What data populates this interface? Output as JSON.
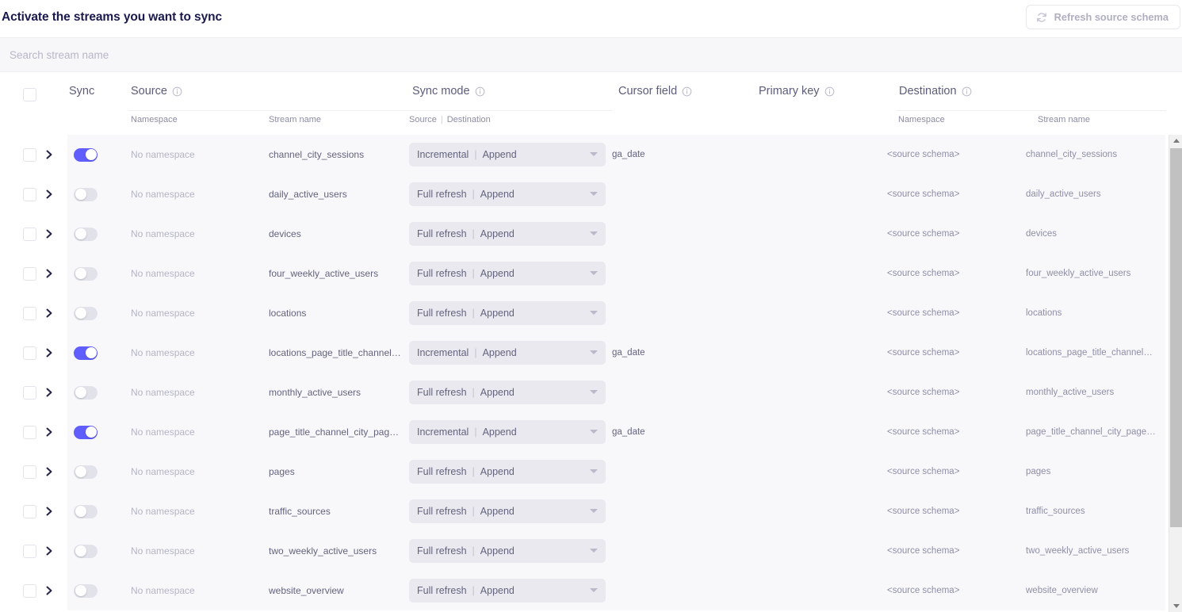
{
  "header": {
    "title": "Activate the streams you want to sync",
    "refresh_button": {
      "label": "Refresh source schema",
      "icon": "refresh-icon",
      "disabled": true
    }
  },
  "search": {
    "value": "",
    "placeholder": "Search stream name"
  },
  "table": {
    "columns": {
      "sync": "Sync",
      "source": "Source",
      "sync_mode": "Sync mode",
      "cursor_field": "Cursor field",
      "primary_key": "Primary key",
      "destination": "Destination"
    },
    "subcolumns": {
      "source_namespace": "Namespace",
      "source_stream_name": "Stream name",
      "sync_mode_source": "Source",
      "sync_mode_separator": "|",
      "sync_mode_destination": "Destination",
      "dest_namespace": "Namespace",
      "dest_stream_name": "Stream name"
    },
    "rows": [
      {
        "enabled": true,
        "checked": false,
        "namespace": "No namespace",
        "stream_name": "channel_city_sessions",
        "sync_mode_source": "Incremental",
        "sync_mode_separator": "|",
        "sync_mode_destination": "Append",
        "cursor_field": "ga_date",
        "primary_key": "",
        "dest_namespace": "<source schema>",
        "dest_stream_name": "channel_city_sessions"
      },
      {
        "enabled": false,
        "checked": false,
        "namespace": "No namespace",
        "stream_name": "daily_active_users",
        "sync_mode_source": "Full refresh",
        "sync_mode_separator": "|",
        "sync_mode_destination": "Append",
        "cursor_field": "",
        "primary_key": "",
        "dest_namespace": "<source schema>",
        "dest_stream_name": "daily_active_users"
      },
      {
        "enabled": false,
        "checked": false,
        "namespace": "No namespace",
        "stream_name": "devices",
        "sync_mode_source": "Full refresh",
        "sync_mode_separator": "|",
        "sync_mode_destination": "Append",
        "cursor_field": "",
        "primary_key": "",
        "dest_namespace": "<source schema>",
        "dest_stream_name": "devices"
      },
      {
        "enabled": false,
        "checked": false,
        "namespace": "No namespace",
        "stream_name": "four_weekly_active_users",
        "sync_mode_source": "Full refresh",
        "sync_mode_separator": "|",
        "sync_mode_destination": "Append",
        "cursor_field": "",
        "primary_key": "",
        "dest_namespace": "<source schema>",
        "dest_stream_name": "four_weekly_active_users"
      },
      {
        "enabled": false,
        "checked": false,
        "namespace": "No namespace",
        "stream_name": "locations",
        "sync_mode_source": "Full refresh",
        "sync_mode_separator": "|",
        "sync_mode_destination": "Append",
        "cursor_field": "",
        "primary_key": "",
        "dest_namespace": "<source schema>",
        "dest_stream_name": "locations"
      },
      {
        "enabled": true,
        "checked": false,
        "namespace": "No namespace",
        "stream_name": "locations_page_title_channel_cit...",
        "sync_mode_source": "Incremental",
        "sync_mode_separator": "|",
        "sync_mode_destination": "Append",
        "cursor_field": "ga_date",
        "primary_key": "",
        "dest_namespace": "<source schema>",
        "dest_stream_name": "locations_page_title_channel_cit..."
      },
      {
        "enabled": false,
        "checked": false,
        "namespace": "No namespace",
        "stream_name": "monthly_active_users",
        "sync_mode_source": "Full refresh",
        "sync_mode_separator": "|",
        "sync_mode_destination": "Append",
        "cursor_field": "",
        "primary_key": "",
        "dest_namespace": "<source schema>",
        "dest_stream_name": "monthly_active_users"
      },
      {
        "enabled": true,
        "checked": false,
        "namespace": "No namespace",
        "stream_name": "page_title_channel_city_pagevie...",
        "sync_mode_source": "Incremental",
        "sync_mode_separator": "|",
        "sync_mode_destination": "Append",
        "cursor_field": "ga_date",
        "primary_key": "",
        "dest_namespace": "<source schema>",
        "dest_stream_name": "page_title_channel_city_pagevie..."
      },
      {
        "enabled": false,
        "checked": false,
        "namespace": "No namespace",
        "stream_name": "pages",
        "sync_mode_source": "Full refresh",
        "sync_mode_separator": "|",
        "sync_mode_destination": "Append",
        "cursor_field": "",
        "primary_key": "",
        "dest_namespace": "<source schema>",
        "dest_stream_name": "pages"
      },
      {
        "enabled": false,
        "checked": false,
        "namespace": "No namespace",
        "stream_name": "traffic_sources",
        "sync_mode_source": "Full refresh",
        "sync_mode_separator": "|",
        "sync_mode_destination": "Append",
        "cursor_field": "",
        "primary_key": "",
        "dest_namespace": "<source schema>",
        "dest_stream_name": "traffic_sources"
      },
      {
        "enabled": false,
        "checked": false,
        "namespace": "No namespace",
        "stream_name": "two_weekly_active_users",
        "sync_mode_source": "Full refresh",
        "sync_mode_separator": "|",
        "sync_mode_destination": "Append",
        "cursor_field": "",
        "primary_key": "",
        "dest_namespace": "<source schema>",
        "dest_stream_name": "two_weekly_active_users"
      },
      {
        "enabled": false,
        "checked": false,
        "namespace": "No namespace",
        "stream_name": "website_overview",
        "sync_mode_source": "Full refresh",
        "sync_mode_separator": "|",
        "sync_mode_destination": "Append",
        "cursor_field": "",
        "primary_key": "",
        "dest_namespace": "<source schema>",
        "dest_stream_name": "website_overview"
      }
    ]
  },
  "colors": {
    "accent": "#615eff",
    "title": "#1a194d",
    "row_bg": "#f8f8fb",
    "control_bg": "#e9e9ef",
    "muted_text": "#b4b4c4"
  }
}
